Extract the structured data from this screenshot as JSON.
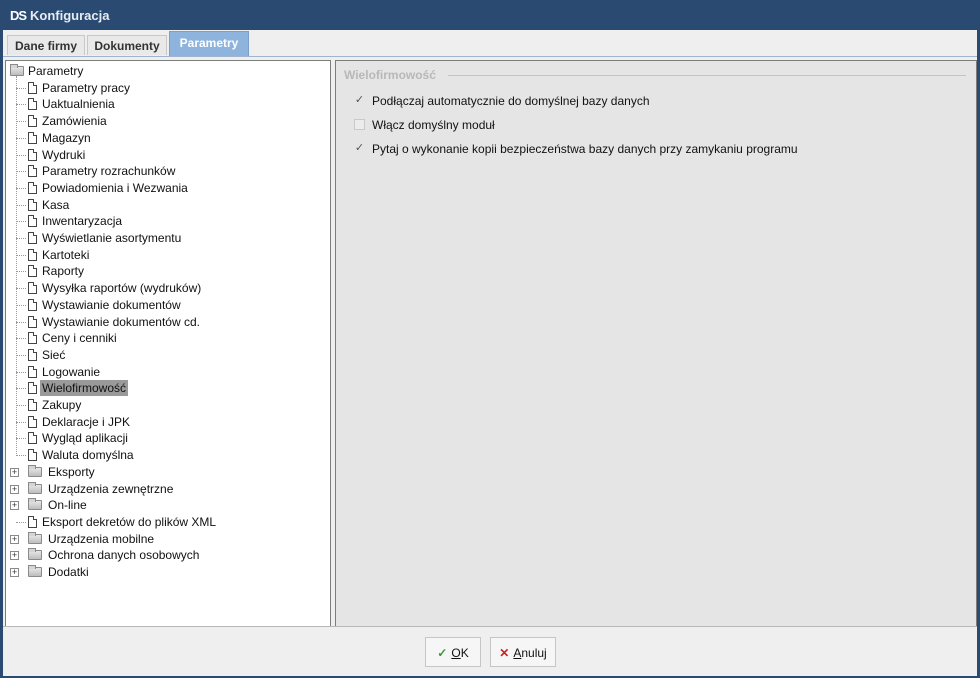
{
  "window": {
    "logo": "DS",
    "title": "Konfiguracja"
  },
  "tabs": [
    {
      "label": "Dane firmy",
      "active": false
    },
    {
      "label": "Dokumenty",
      "active": false
    },
    {
      "label": "Parametry",
      "active": true
    }
  ],
  "tree": {
    "root": "Parametry",
    "children": [
      "Parametry pracy",
      "Uaktualnienia",
      "Zamówienia",
      "Magazyn",
      "Wydruki",
      "Parametry rozrachunków",
      "Powiadomienia i Wezwania",
      "Kasa",
      "Inwentaryzacja",
      "Wyświetlanie asortymentu",
      "Kartoteki",
      "Raporty",
      "Wysyłka raportów (wydruków)",
      "Wystawianie dokumentów",
      "Wystawianie dokumentów cd.",
      "Ceny i cenniki",
      "Sieć",
      "Logowanie",
      "Wielofirmowość",
      "Zakupy",
      "Deklaracje i JPK",
      "Wygląd aplikacji",
      "Waluta domyślna"
    ],
    "selected": "Wielofirmowość",
    "top_level": [
      {
        "label": "Eksporty",
        "type": "folder"
      },
      {
        "label": "Urządzenia zewnętrzne",
        "type": "folder"
      },
      {
        "label": "On-line",
        "type": "folder"
      },
      {
        "label": "Eksport dekretów do plików XML",
        "type": "doc"
      },
      {
        "label": "Urządzenia mobilne",
        "type": "folder"
      },
      {
        "label": "Ochrona danych osobowych",
        "type": "folder"
      },
      {
        "label": "Dodatki",
        "type": "folder"
      }
    ]
  },
  "panel": {
    "group_title": "Wielofirmowość",
    "options": [
      {
        "label": "Podłączaj automatycznie do domyślnej bazy danych",
        "checked": true
      },
      {
        "label": "Włącz domyślny moduł",
        "checked": false
      },
      {
        "label": "Pytaj o wykonanie kopii bezpieczeństwa bazy danych przy zamykaniu programu",
        "checked": true
      }
    ]
  },
  "buttons": {
    "ok_icon": "✓",
    "ok_underlined": "O",
    "ok_rest": "K",
    "cancel_icon": "✕",
    "cancel_underlined": "A",
    "cancel_rest": "nuluj"
  },
  "colors": {
    "titlebar": "#2b4a72",
    "active_tab": "#8eb3dc",
    "selection": "#9a9a9a",
    "ok_icon": "#3a9a3a",
    "cancel_icon": "#cc2222"
  }
}
